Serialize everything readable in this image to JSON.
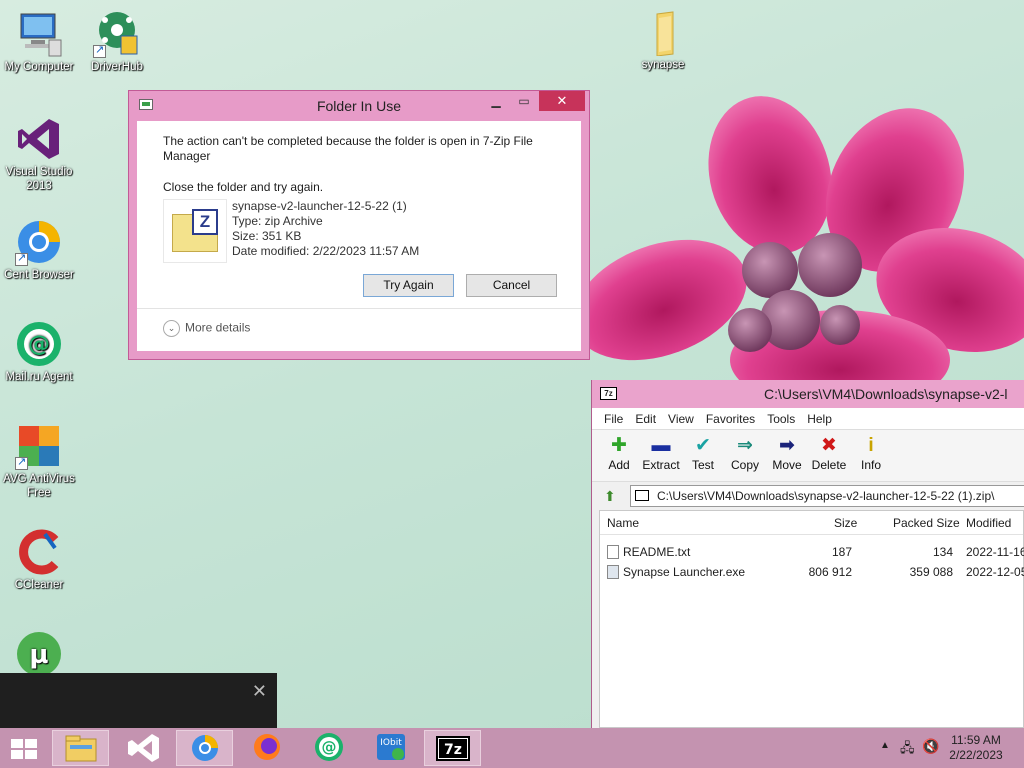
{
  "desktop": {
    "icons": [
      {
        "label": "My Computer"
      },
      {
        "label": "DriverHub"
      },
      {
        "label": "Visual Studio 2013"
      },
      {
        "label": "Cent Browser"
      },
      {
        "label": "Mail.ru Agent"
      },
      {
        "label": "AVG AntiVirus Free"
      },
      {
        "label": "CCleaner"
      },
      {
        "label": "synapse"
      }
    ]
  },
  "dialog": {
    "title": "Folder In Use",
    "message": "The action can't be completed because the folder is open in 7-Zip File Manager",
    "instruction": "Close the folder and try again.",
    "file": {
      "name": "synapse-v2-launcher-12-5-22 (1)",
      "type": "Type: zip Archive",
      "size": "Size: 351 KB",
      "modified": "Date modified: 2/22/2023 11:57 AM"
    },
    "try_again_label": "Try Again",
    "cancel_label": "Cancel",
    "more_details_label": "More details"
  },
  "zipwindow": {
    "title": "C:\\Users\\VM4\\Downloads\\synapse-v2-l",
    "menu": [
      "File",
      "Edit",
      "View",
      "Favorites",
      "Tools",
      "Help"
    ],
    "toolbar": [
      {
        "label": "Add",
        "icon": "plus-icon",
        "color": "#2fa52a"
      },
      {
        "label": "Extract",
        "icon": "minus-icon",
        "color": "#1a2fa0"
      },
      {
        "label": "Test",
        "icon": "check-icon",
        "color": "#1aa3a3"
      },
      {
        "label": "Copy",
        "icon": "double-arrow-icon",
        "color": "#1a8a7a"
      },
      {
        "label": "Move",
        "icon": "arrow-right-icon",
        "color": "#1a237a"
      },
      {
        "label": "Delete",
        "icon": "delete-x-icon",
        "color": "#d01818"
      },
      {
        "label": "Info",
        "icon": "info-icon",
        "color": "#c9a400"
      }
    ],
    "address": "C:\\Users\\VM4\\Downloads\\synapse-v2-launcher-12-5-22 (1).zip\\",
    "columns": {
      "name": "Name",
      "size": "Size",
      "packed": "Packed Size",
      "modified": "Modified"
    },
    "rows": [
      {
        "name": "README.txt",
        "size": "187",
        "packed": "134",
        "modified": "2022-11-16"
      },
      {
        "name": "Synapse Launcher.exe",
        "size": "806 912",
        "packed": "359 088",
        "modified": "2022-12-05"
      }
    ]
  },
  "taskbar": {
    "time": "11:59 AM",
    "date": "2/22/2023"
  }
}
